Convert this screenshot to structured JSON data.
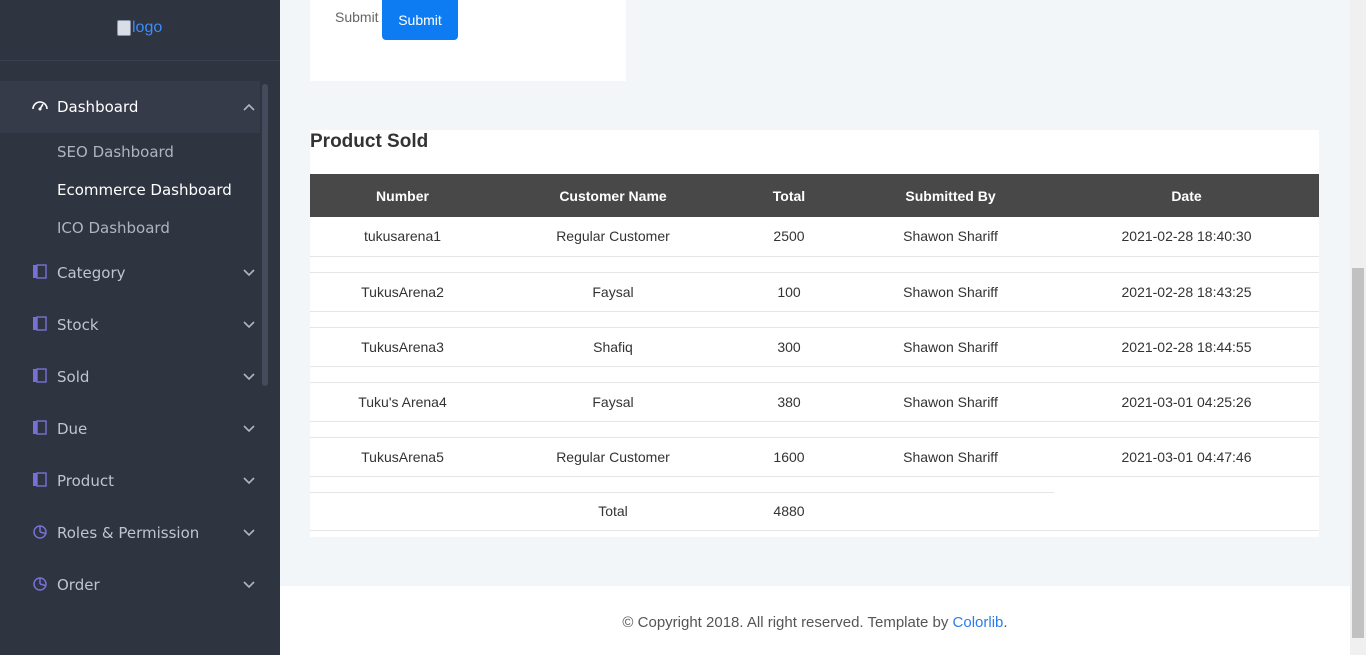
{
  "logo": {
    "alt": "logo"
  },
  "sidebar": {
    "dashboard_label": "Dashboard",
    "sub_items": [
      "SEO Dashboard",
      "Ecommerce Dashboard",
      "ICO Dashboard"
    ],
    "items": [
      {
        "label": "Category",
        "icon": "book-icon"
      },
      {
        "label": "Stock",
        "icon": "book-icon"
      },
      {
        "label": "Sold",
        "icon": "book-icon"
      },
      {
        "label": "Due",
        "icon": "book-icon"
      },
      {
        "label": "Product",
        "icon": "book-icon"
      },
      {
        "label": "Roles & Permission",
        "icon": "pie-chart-icon"
      },
      {
        "label": "Order",
        "icon": "pie-chart-icon"
      }
    ]
  },
  "form": {
    "submit_text": "Submit",
    "submit_button": "Submit"
  },
  "table_card": {
    "title": "Product Sold",
    "headers": [
      "Number",
      "Customer Name",
      "Total",
      "Submitted By",
      "Date"
    ],
    "rows": [
      [
        "tukusarena1",
        "Regular Customer",
        "2500",
        "Shawon Shariff",
        "2021-02-28 18:40:30"
      ],
      [
        "TukusArena2",
        "Faysal",
        "100",
        "Shawon Shariff",
        "2021-02-28 18:43:25"
      ],
      [
        "TukusArena3",
        "Shafiq",
        "300",
        "Shawon Shariff",
        "2021-02-28 18:44:55"
      ],
      [
        "Tuku's Arena4",
        "Faysal",
        "380",
        "Shawon Shariff",
        "2021-03-01 04:25:26"
      ],
      [
        "TukusArena5",
        "Regular Customer",
        "1600",
        "Shawon Shariff",
        "2021-03-01 04:47:46"
      ]
    ],
    "total_label": "Total",
    "total_value": "4880"
  },
  "footer": {
    "text": "© Copyright 2018. All right reserved. Template by ",
    "link": "Colorlib",
    "suffix": "."
  },
  "colors": {
    "sidebar_bg": "#2f3441",
    "accent": "#0d7cf2",
    "table_header": "#484848",
    "icon_purple": "#7b6fd6"
  }
}
